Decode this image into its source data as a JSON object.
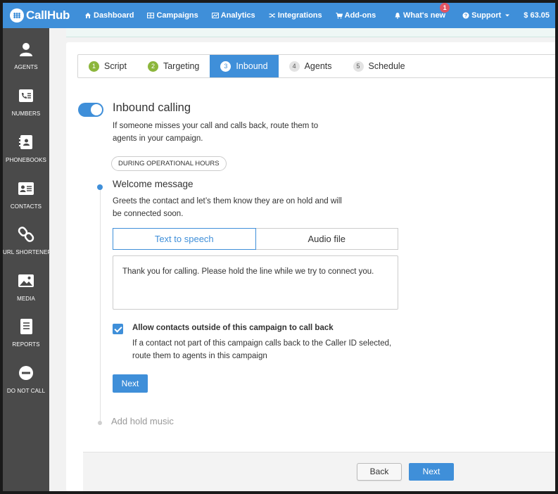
{
  "app": {
    "brand": "CallHub"
  },
  "topnav": {
    "items": [
      {
        "label": "Dashboard",
        "icon": "home-icon"
      },
      {
        "label": "Campaigns",
        "icon": "grid-icon"
      },
      {
        "label": "Analytics",
        "icon": "chart-icon"
      },
      {
        "label": "Integrations",
        "icon": "shuffle-icon"
      },
      {
        "label": "Add-ons",
        "icon": "cart-icon"
      }
    ],
    "whats_new": "What's new",
    "notification_count": "1",
    "support": "Support",
    "balance": "$ 63.05"
  },
  "sidebar": {
    "items": [
      {
        "label": "AGENTS",
        "icon": "person-icon"
      },
      {
        "label": "NUMBERS",
        "icon": "phone-list-icon"
      },
      {
        "label": "PHONEBOOKS",
        "icon": "phonebook-icon"
      },
      {
        "label": "CONTACTS",
        "icon": "contact-card-icon"
      },
      {
        "label": "URL SHORTENER",
        "icon": "link-icon"
      },
      {
        "label": "MEDIA",
        "icon": "image-icon"
      },
      {
        "label": "REPORTS",
        "icon": "report-icon"
      },
      {
        "label": "DO NOT CALL",
        "icon": "block-icon"
      }
    ]
  },
  "stepper": {
    "steps": [
      {
        "num": "1",
        "label": "Script",
        "state": "done"
      },
      {
        "num": "2",
        "label": "Targeting",
        "state": "done"
      },
      {
        "num": "3",
        "label": "Inbound",
        "state": "active"
      },
      {
        "num": "4",
        "label": "Agents",
        "state": "todo"
      },
      {
        "num": "5",
        "label": "Schedule",
        "state": "todo"
      }
    ]
  },
  "inbound": {
    "title": "Inbound calling",
    "description": "If someone misses your call and calls back, route them to agents in your campaign.",
    "toggle_on": true,
    "hours_pill": "DURING OPERATIONAL HOURS",
    "welcome_title": "Welcome message",
    "welcome_desc": "Greets the contact and let’s them know they are on hold and will be connected soon.",
    "tab_tts": "Text to speech",
    "tab_audio": "Audio file",
    "tts_text": "Thank you for calling. Please hold the line while we try to connect you.",
    "allow_label": "Allow contacts outside of this campaign to call back",
    "allow_desc": "If a contact not part of this campaign calls back to the Caller ID selected, route them to agents in this campaign",
    "allow_checked": true,
    "next_label": "Next",
    "hold_music": "Add hold music"
  },
  "footer": {
    "back_label": "Back",
    "next_label": "Next"
  },
  "colors": {
    "primary": "#3f8fd9",
    "sidebar": "#4a4a4a",
    "step_done": "#8cb63c",
    "badge": "#e25462"
  }
}
